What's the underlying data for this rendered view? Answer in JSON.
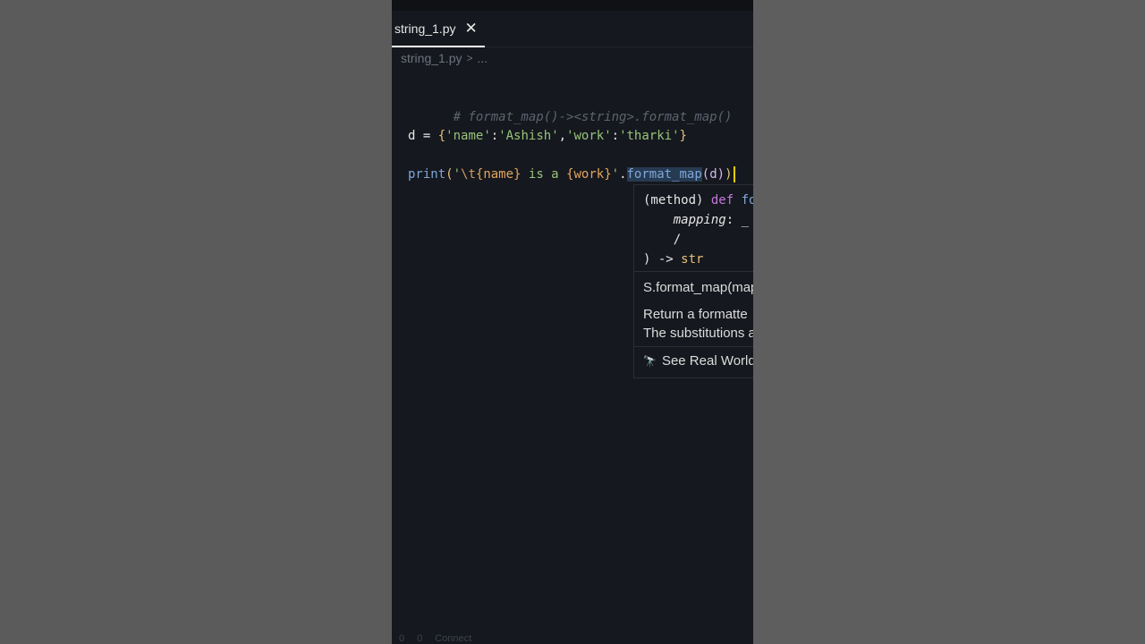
{
  "tab": {
    "label": "string_1.py",
    "close_icon": "close-icon"
  },
  "breadcrumb": {
    "file": "string_1.py",
    "more": "..."
  },
  "code": {
    "comment": "# format_map()-><string>.format_map()",
    "line2": {
      "var": "d",
      "eq": " = ",
      "open": "{",
      "k1": "'name'",
      "colon1": ":",
      "v1": "'Ashish'",
      "comma": ",",
      "k2": "'work'",
      "colon2": ":",
      "v2": "'tharki'",
      "close": "}"
    },
    "line3": {
      "print": "print",
      "lparen": "(",
      "q1": "'",
      "esc": "\\t",
      "name": "{name}",
      "mid": " is a ",
      "work": "{work}",
      "q2": "'",
      "dot": ".",
      "method": "format_map",
      "arg": "(d)",
      "rparen": ")"
    }
  },
  "hover": {
    "sig1_method": "(method) ",
    "sig1_def": "def ",
    "sig1_name": "fo",
    "sig2_param": "    mapping",
    "sig2_rest": ": _",
    "sig3": "    /",
    "sig4_close": ") -> ",
    "sig4_type": "str",
    "doc_title": "S.format_map(map",
    "doc_line1": "Return a formatte",
    "doc_line2": "The substitutions a",
    "link": "See Real World",
    "link_icon": "telescope-icon"
  },
  "status": {
    "errors": "0",
    "warnings": "0",
    "connect": "Connect"
  }
}
